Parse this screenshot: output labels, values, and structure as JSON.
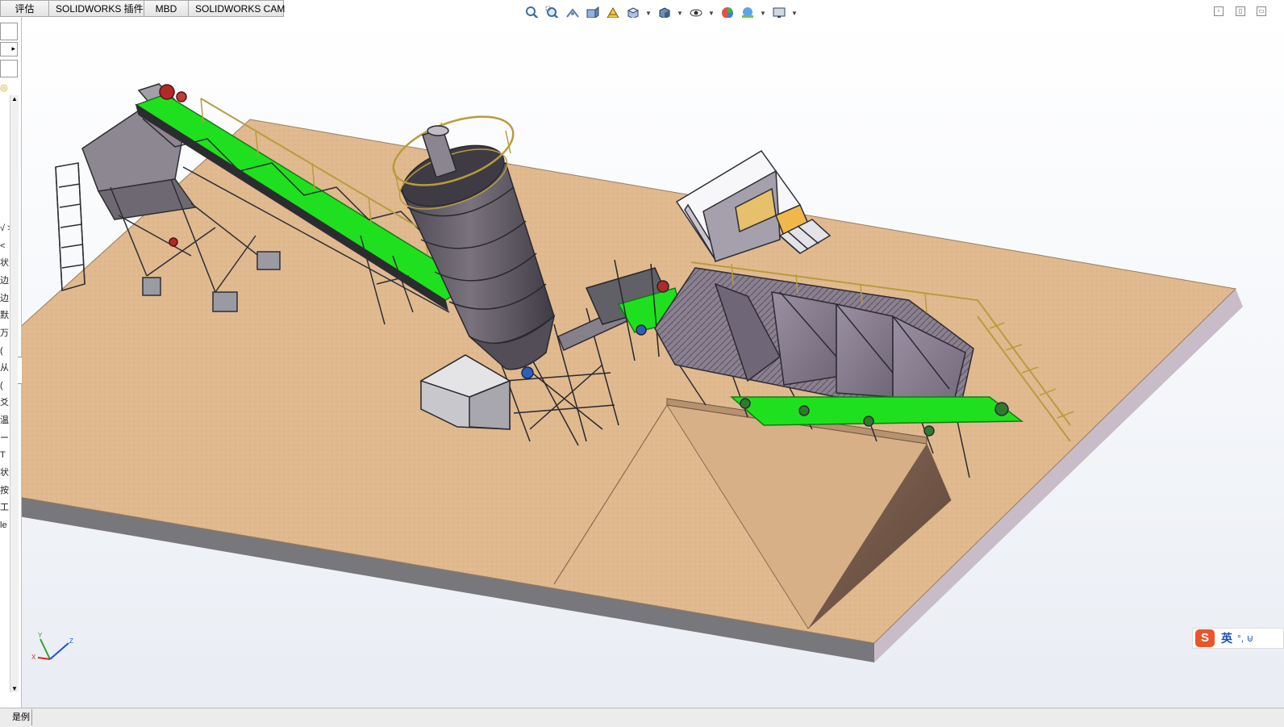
{
  "command_tabs": [
    {
      "label": "评估"
    },
    {
      "label": "SOLIDWORKS 插件"
    },
    {
      "label": "MBD"
    },
    {
      "label": "SOLIDWORKS CAM"
    }
  ],
  "sidebar": {
    "fragments": [
      "√ >",
      "<",
      "状",
      "边",
      "边",
      "默",
      "万",
      "(",
      "从",
      "(",
      "爻",
      "温",
      "ー",
      "T",
      "状",
      "按",
      "工",
      "le"
    ]
  },
  "heads_up_toolbar": [
    {
      "icon": "zoom-to-fit-icon"
    },
    {
      "icon": "zoom-to-area-icon"
    },
    {
      "icon": "previous-view-icon"
    },
    {
      "icon": "section-view-icon"
    },
    {
      "icon": "dynamic-annotation-icon"
    },
    {
      "icon": "view-orientation-icon"
    },
    {
      "icon": "display-style-icon"
    },
    {
      "icon": "hide-show-items-icon"
    },
    {
      "icon": "edit-appearance-icon"
    },
    {
      "icon": "apply-scene-icon"
    },
    {
      "icon": "view-settings-icon"
    }
  ],
  "triad": {
    "x_label": "X",
    "y_label": "Y",
    "z_label": "Z"
  },
  "ime": {
    "logo": "S",
    "lang": "英",
    "punct": "°, ⊍"
  },
  "status": {
    "tab_label": "是例"
  },
  "colors": {
    "ground_top": "#e0b98f",
    "ground_side": "#77777c",
    "ground_front": "#c9bcc9",
    "conveyor_belt": "#1fe01f",
    "steel": "#4a4a50",
    "silo_body": "#5f5a63",
    "hopper": "#8b8193",
    "railing": "#b89c3e"
  }
}
